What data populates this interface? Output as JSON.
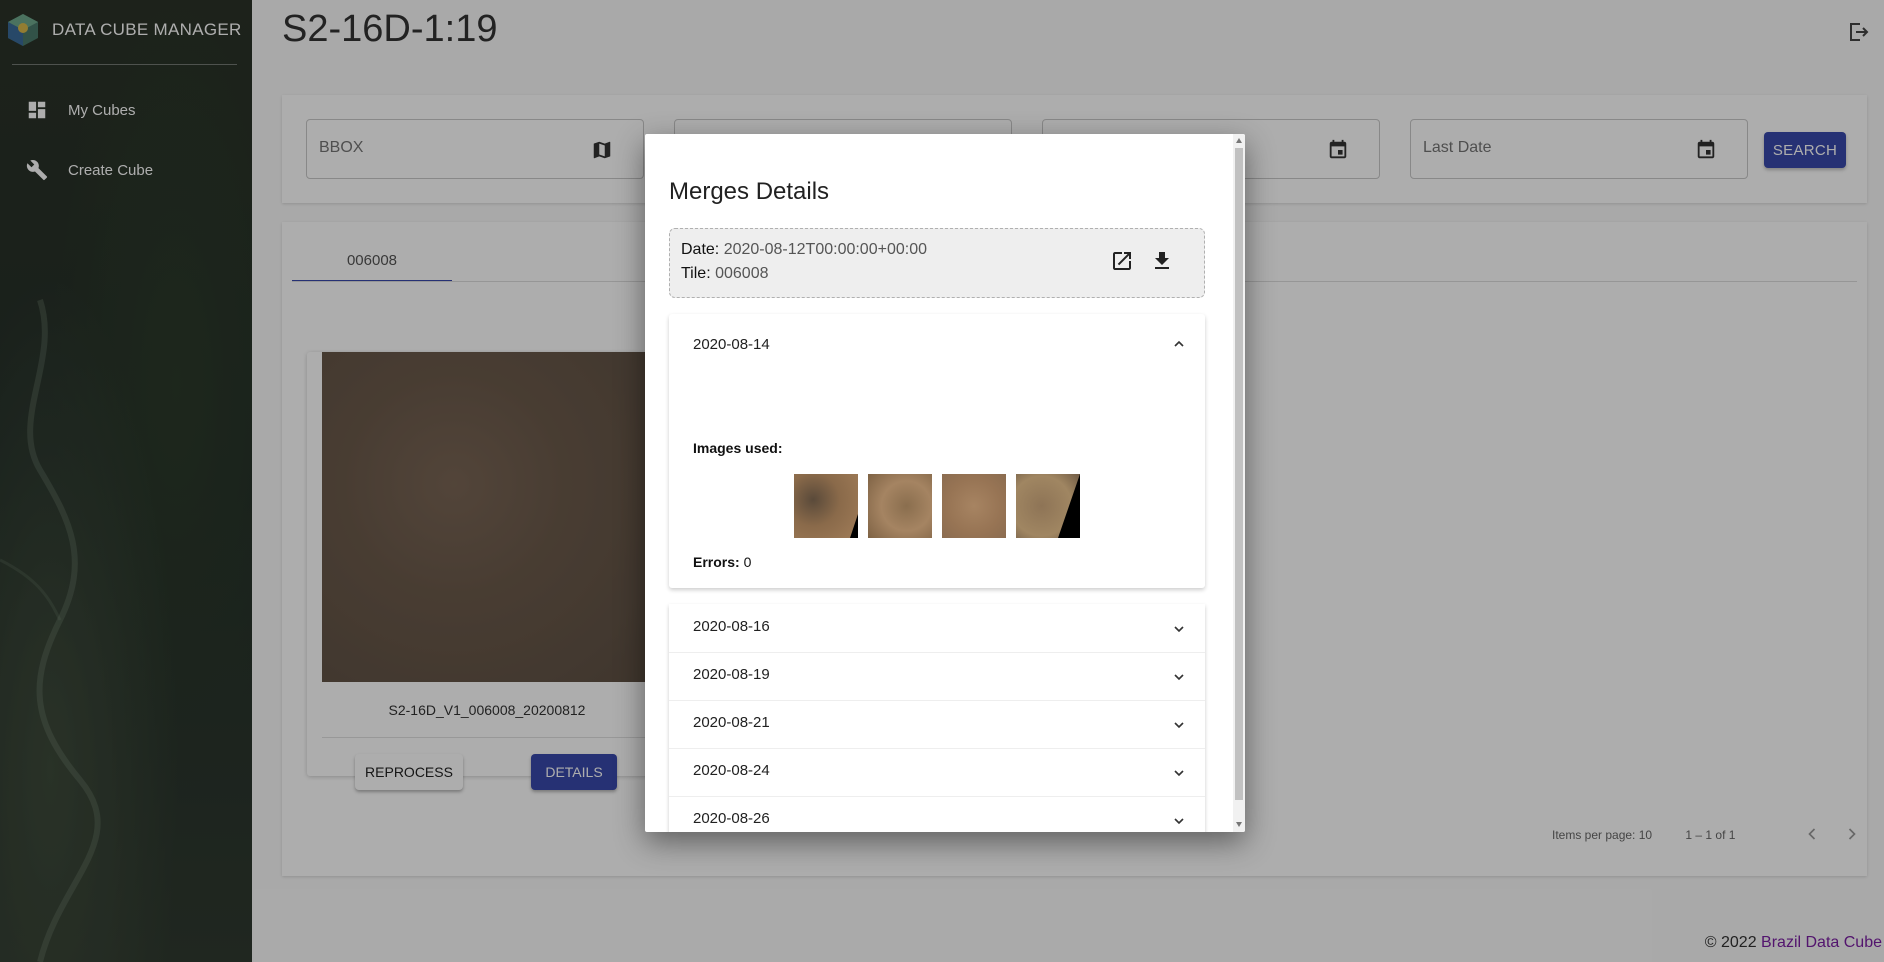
{
  "app": {
    "brand": "DATA CUBE MANAGER"
  },
  "sidebar": {
    "items": [
      {
        "label": "My Cubes",
        "icon": "dashboard-icon"
      },
      {
        "label": "Create Cube",
        "icon": "wrench-icon"
      }
    ]
  },
  "header": {
    "title": "S2-16D-1:19"
  },
  "filters": {
    "bbox_placeholder": "BBOX",
    "last_date_placeholder": "Last Date",
    "search_label": "SEARCH"
  },
  "results": {
    "tab_label": "006008",
    "card": {
      "caption": "S2-16D_V1_006008_20200812",
      "reprocess_label": "REPROCESS",
      "details_label": "DETAILS"
    },
    "pager": {
      "items_per_page": "Items per page: 10",
      "range": "1 – 1 of 1"
    }
  },
  "footer": {
    "prefix": "© 2022 ",
    "link": "Brazil Data Cube"
  },
  "dialog": {
    "title": "Merges Details",
    "date_key": "Date:",
    "date_value": "2020-08-12T00:00:00+00:00",
    "tile_key": "Tile:",
    "tile_value": "006008",
    "open_panel": {
      "date": "2020-08-14",
      "images_used_label": "Images used:",
      "images": [
        "scene-1",
        "scene-2",
        "scene-3",
        "scene-4"
      ],
      "errors_label": "Errors:",
      "errors_value": "0"
    },
    "collapsed_panels": [
      "2020-08-16",
      "2020-08-19",
      "2020-08-21",
      "2020-08-24",
      "2020-08-26"
    ]
  },
  "colors": {
    "primary": "#3949ab",
    "link": "#7b1fa2"
  }
}
